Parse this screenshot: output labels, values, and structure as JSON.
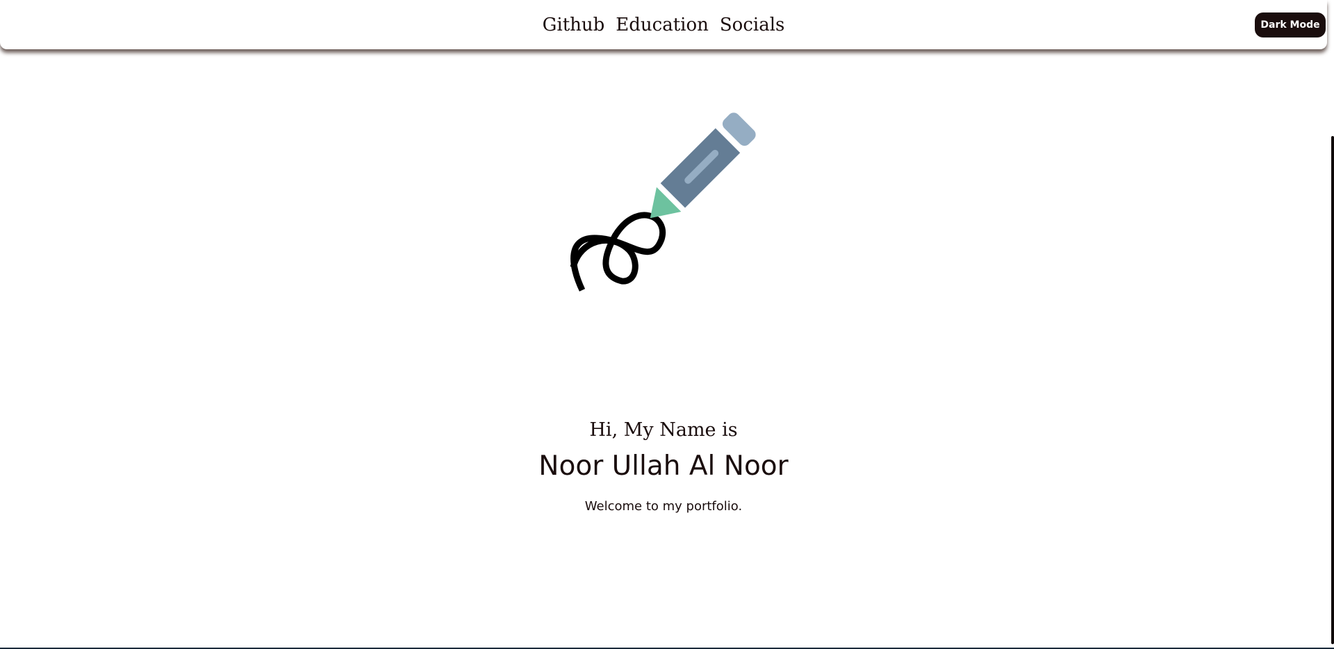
{
  "nav": {
    "links": [
      {
        "label": "Github"
      },
      {
        "label": "Education"
      },
      {
        "label": "Socials"
      }
    ],
    "mode_button_label": "Dark Mode"
  },
  "hero": {
    "illustration_icon": "pen-signature-icon",
    "greeting": "Hi, My Name is",
    "name": "Noor Ullah Al Noor",
    "tagline": "Welcome to my portfolio."
  },
  "colors": {
    "text": "#1a0d0d",
    "button_bg": "#1a0d0d",
    "pen_body": "#647d95",
    "pen_cap": "#95adc3",
    "pen_tip": "#6dc29f",
    "squiggle": "#000000"
  }
}
